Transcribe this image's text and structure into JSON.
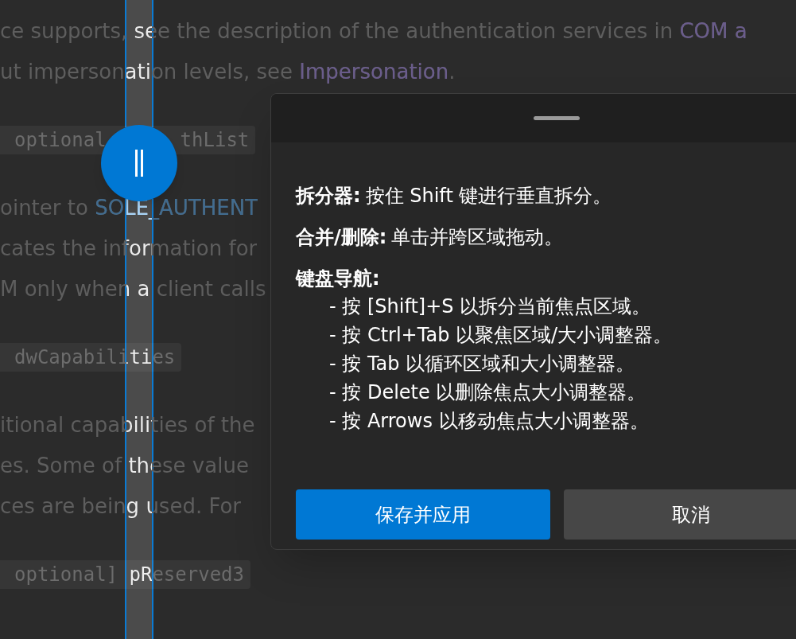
{
  "document": {
    "lines": [
      {
        "kind": "text",
        "segments": [
          {
            "text": "ce supports, see the description of the authentication services in "
          },
          {
            "text": "COM a",
            "kind": "link",
            "visited": true
          }
        ]
      },
      {
        "kind": "text",
        "segments": [
          {
            "text": "ut impersonation levels, see "
          },
          {
            "text": "Impersonation",
            "kind": "link",
            "visited": true
          },
          {
            "text": "."
          }
        ]
      },
      {
        "kind": "code",
        "parts": [
          "optional",
          "thList"
        ]
      },
      {
        "kind": "text",
        "segments": [
          {
            "text": "ointer to "
          },
          {
            "text": "SOLE_AUTHENT",
            "kind": "link",
            "visited": false
          }
        ]
      },
      {
        "kind": "text",
        "segments": [
          {
            "text": "cates the information for"
          }
        ]
      },
      {
        "kind": "text",
        "segments": [
          {
            "text": "M only when a client calls"
          }
        ]
      },
      {
        "kind": "code",
        "parts": [
          "dwCapabilities"
        ]
      },
      {
        "kind": "text",
        "segments": [
          {
            "text": "itional capabilities of the"
          }
        ]
      },
      {
        "kind": "text",
        "segments": [
          {
            "text": "es. Some of these value"
          }
        ]
      },
      {
        "kind": "text",
        "segments": [
          {
            "text": "ces are being used. For"
          }
        ]
      },
      {
        "kind": "code",
        "parts": [
          "optional] pReserved3"
        ]
      }
    ]
  },
  "dialog": {
    "sections": [
      {
        "label": "拆分器:",
        "text": "按住 Shift 键进行垂直拆分。"
      },
      {
        "label": "合并/删除:",
        "text": "单击并跨区域拖动。"
      },
      {
        "label": "键盘导航:",
        "items": [
          "- 按 [Shift]+S 以拆分当前焦点区域。",
          "- 按 Ctrl+Tab 以聚焦区域/大小调整器。",
          "- 按 Tab 以循环区域和大小调整器。",
          "- 按 Delete 以删除焦点大小调整器。",
          "- 按 Arrows 以移动焦点大小调整器。"
        ]
      }
    ],
    "buttons": [
      {
        "label": "保存并应用",
        "kind": "primary"
      },
      {
        "label": "取消",
        "kind": "secondary"
      }
    ]
  }
}
